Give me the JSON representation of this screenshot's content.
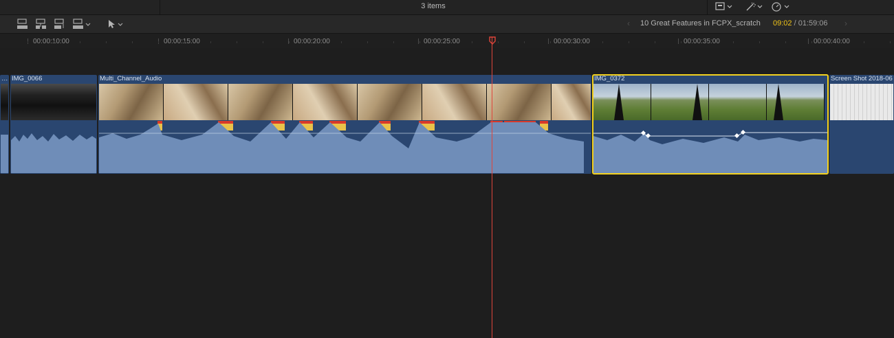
{
  "header": {
    "items_count": "3 items"
  },
  "toolbar": {
    "project_name": "10 Great Features in FCPX_scratch",
    "timecode_current": "09:02",
    "timecode_separator": " / ",
    "timecode_total": "01:59:06"
  },
  "ruler": {
    "labels": [
      "00:00:10:00",
      "00:00:15:00",
      "00:00:20:00",
      "00:00:25:00",
      "00:00:30:00",
      "00:00:35:00",
      "00:00:40:00"
    ]
  },
  "clips": [
    {
      "name": "…"
    },
    {
      "name": "IMG_0066"
    },
    {
      "name": "Multi_Channel_Audio"
    },
    {
      "name": "IMG_0372",
      "selected": true
    },
    {
      "name": "Screen Shot 2018-06"
    }
  ],
  "colors": {
    "selection": "#f4d21f",
    "playhead": "#e0453a",
    "timecode": "#f0c419",
    "clip": "#2a4670",
    "waveform": "#6f8db8"
  }
}
